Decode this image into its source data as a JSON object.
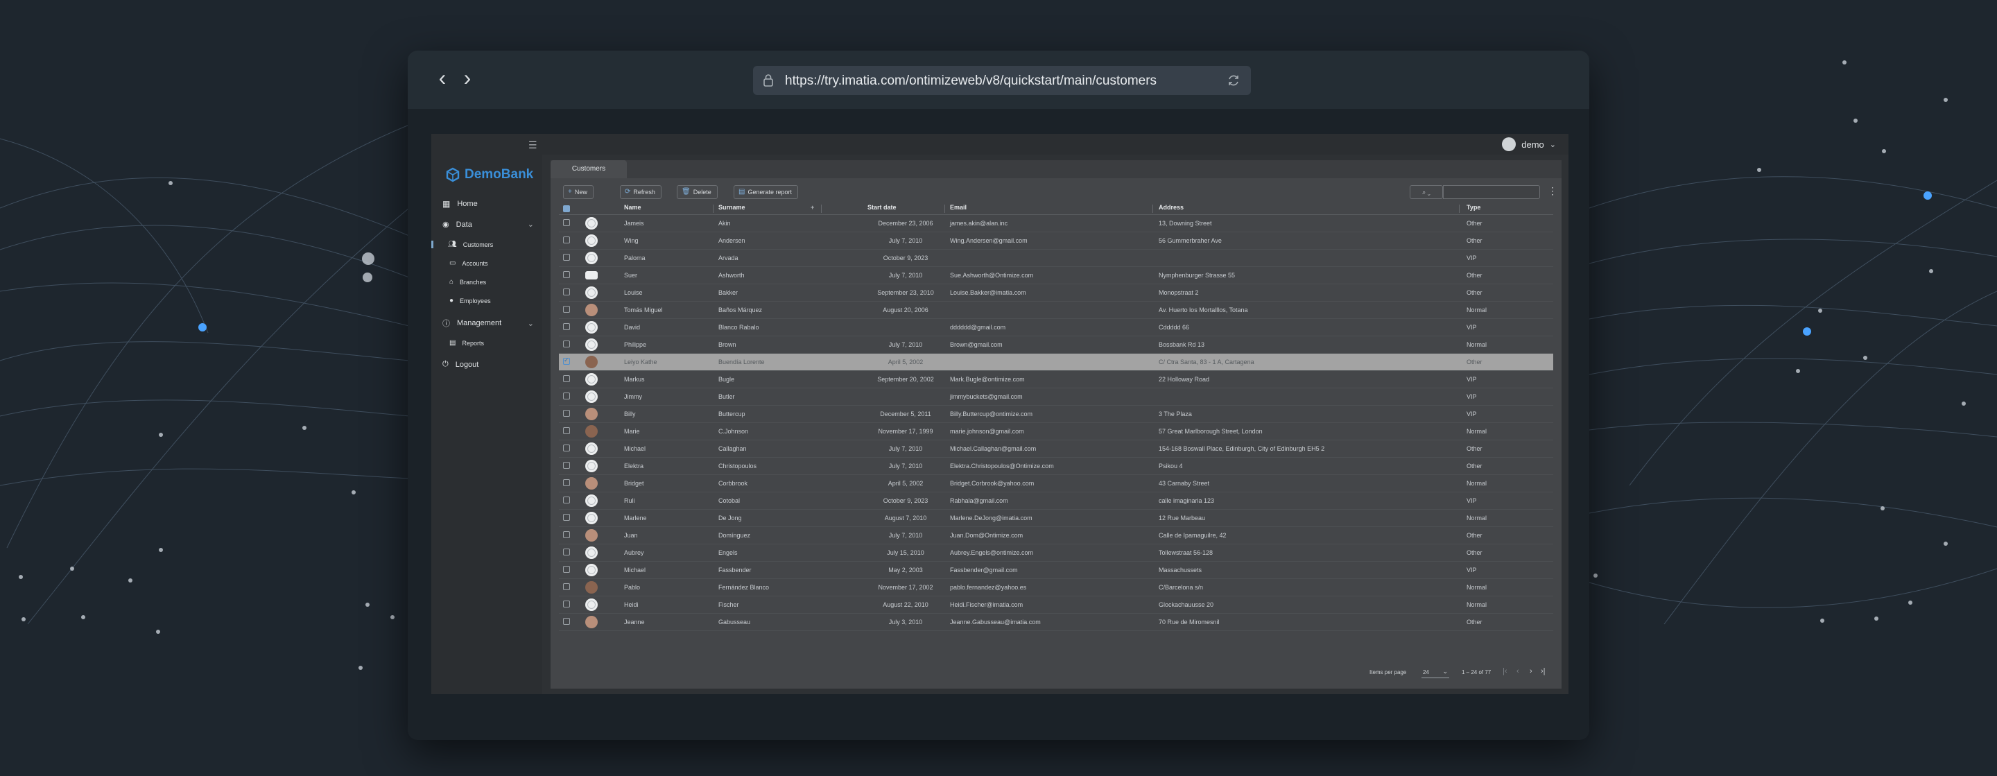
{
  "browser": {
    "url": "https://try.imatia.com/ontimizeweb/v8/quickstart/main/customers",
    "back_icon": "‹",
    "forward_icon": "›"
  },
  "app": {
    "brand": "DemoBank",
    "user": "demo",
    "accent": "#3a8fd9"
  },
  "sidebar": {
    "home": "Home",
    "data": "Data",
    "customers": "Customers",
    "accounts": "Accounts",
    "branches": "Branches",
    "employees": "Employees",
    "management": "Management",
    "reports": "Reports",
    "logout": "Logout"
  },
  "tab": {
    "label": "Customers"
  },
  "toolbar": {
    "new": "New",
    "refresh": "Refresh",
    "delete": "Delete",
    "report": "Generate report",
    "search_placeholder": ""
  },
  "table": {
    "columns": [
      "Name",
      "Surname",
      "Start date",
      "Email",
      "Address",
      "Type"
    ],
    "rows": [
      {
        "name": "Jameis",
        "surname": "Akin",
        "date": "December 23, 2006",
        "email": "james.akin@alan.inc",
        "address": "13, Downing Street",
        "type": "Other",
        "avatar": "placeholder"
      },
      {
        "name": "Wing",
        "surname": "Andersen",
        "date": "July 7, 2010",
        "email": "Wing.Andersen@gmail.com",
        "address": "56 Gummerbraher Ave",
        "type": "Other",
        "avatar": "placeholder"
      },
      {
        "name": "Paloma",
        "surname": "Arvada",
        "date": "October 9, 2023",
        "email": "",
        "address": "",
        "type": "VIP",
        "avatar": "placeholder"
      },
      {
        "name": "Suer",
        "surname": "Ashworth",
        "date": "July 7, 2010",
        "email": "Sue.Ashworth@Ontimize.com",
        "address": "Nymphenburger Strasse 55",
        "type": "Other",
        "avatar": "flat"
      },
      {
        "name": "Louise",
        "surname": "Bakker",
        "date": "September 23, 2010",
        "email": "Louise.Bakker@imatia.com",
        "address": "Monopstraat 2",
        "type": "Other",
        "avatar": "placeholder"
      },
      {
        "name": "Tomás Miguel",
        "surname": "Baños Márquez",
        "date": "August 20, 2006",
        "email": "",
        "address": "Av. Huerto los Mortalllos, Totana",
        "type": "Normal",
        "avatar": "photo"
      },
      {
        "name": "David",
        "surname": "Blanco Rabalo",
        "date": "",
        "email": "dddddd@gmail.com",
        "address": "Cddddd 66",
        "type": "VIP",
        "avatar": "placeholder"
      },
      {
        "name": "Philippe",
        "surname": "Brown",
        "date": "July 7, 2010",
        "email": "Brown@gmail.com",
        "address": "Bossbank Rd 13",
        "type": "Normal",
        "avatar": "placeholder"
      },
      {
        "name": "Leiyo Kathe",
        "surname": "Buendía Lorente",
        "date": "April 5, 2002",
        "email": "",
        "address": "C/ Ctra Santa, 83 - 1 A, Cartagena",
        "type": "Other",
        "avatar": "photo2",
        "selected": true
      },
      {
        "name": "Markus",
        "surname": "Bugle",
        "date": "September 20, 2002",
        "email": "Mark.Bugle@ontimize.com",
        "address": "22 Holloway Road",
        "type": "VIP",
        "avatar": "placeholder"
      },
      {
        "name": "Jimmy",
        "surname": "Butler",
        "date": "",
        "email": "jimmybuckets@gmail.com",
        "address": "",
        "type": "VIP",
        "avatar": "placeholder"
      },
      {
        "name": "Billy",
        "surname": "Buttercup",
        "date": "December 5, 2011",
        "email": "Billy.Buttercup@ontimize.com",
        "address": "3 The Plaza",
        "type": "VIP",
        "avatar": "photo"
      },
      {
        "name": "Marie",
        "surname": "C.Johnson",
        "date": "November 17, 1999",
        "email": "marie.johnson@gmail.com",
        "address": "57 Great Marlborough Street, London",
        "type": "Normal",
        "avatar": "photo2"
      },
      {
        "name": "Michael",
        "surname": "Callaghan",
        "date": "July 7, 2010",
        "email": "Michael.Callaghan@gmail.com",
        "address": "154-168 Boswall Place, Edinburgh, City of Edinburgh EH5 2",
        "type": "Other",
        "avatar": "placeholder"
      },
      {
        "name": "Elektra",
        "surname": "Christopoulos",
        "date": "July 7, 2010",
        "email": "Elektra.Christopoulos@Ontimize.com",
        "address": "Psikou 4",
        "type": "Other",
        "avatar": "placeholder"
      },
      {
        "name": "Bridget",
        "surname": "Corbbrook",
        "date": "April 5, 2002",
        "email": "Bridget.Corbrook@yahoo.com",
        "address": "43 Carnaby Street",
        "type": "Normal",
        "avatar": "photo"
      },
      {
        "name": "Ruli",
        "surname": "Cotobal",
        "date": "October 9, 2023",
        "email": "Rabhala@gmail.com",
        "address": "calle imaginaria 123",
        "type": "VIP",
        "avatar": "placeholder"
      },
      {
        "name": "Marlene",
        "surname": "De Jong",
        "date": "August 7, 2010",
        "email": "Marlene.DeJong@imatia.com",
        "address": "12 Rue Marbeau",
        "type": "Normal",
        "avatar": "placeholder"
      },
      {
        "name": "Juan",
        "surname": "Domínguez",
        "date": "July 7, 2010",
        "email": "Juan.Dom@Ontimize.com",
        "address": "Calle de Ipamaguilre, 42",
        "type": "Other",
        "avatar": "photo"
      },
      {
        "name": "Aubrey",
        "surname": "Engels",
        "date": "July 15, 2010",
        "email": "Aubrey.Engels@ontimize.com",
        "address": "Tollewstraat 56-128",
        "type": "Other",
        "avatar": "placeholder"
      },
      {
        "name": "Michael",
        "surname": "Fassbender",
        "date": "May 2, 2003",
        "email": "Fassbender@gmail.com",
        "address": "Massachussets",
        "type": "VIP",
        "avatar": "placeholder"
      },
      {
        "name": "Pablo",
        "surname": "Fernández Blanco",
        "date": "November 17, 2002",
        "email": "pablo.fernandez@yahoo.es",
        "address": "C/Barcelona s/n",
        "type": "Normal",
        "avatar": "photo2"
      },
      {
        "name": "Heidi",
        "surname": "Fischer",
        "date": "August 22, 2010",
        "email": "Heidi.Fischer@imatia.com",
        "address": "Glockachauusse 20",
        "type": "Normal",
        "avatar": "placeholder"
      },
      {
        "name": "Jeanne",
        "surname": "Gabusseau",
        "date": "July 3, 2010",
        "email": "Jeanne.Gabusseau@imatia.com",
        "address": "70 Rue de Miromesnil",
        "type": "Other",
        "avatar": "photo"
      }
    ]
  },
  "pagination": {
    "label": "Items per page",
    "page_size": "24",
    "range": "1 – 24 of 77"
  }
}
